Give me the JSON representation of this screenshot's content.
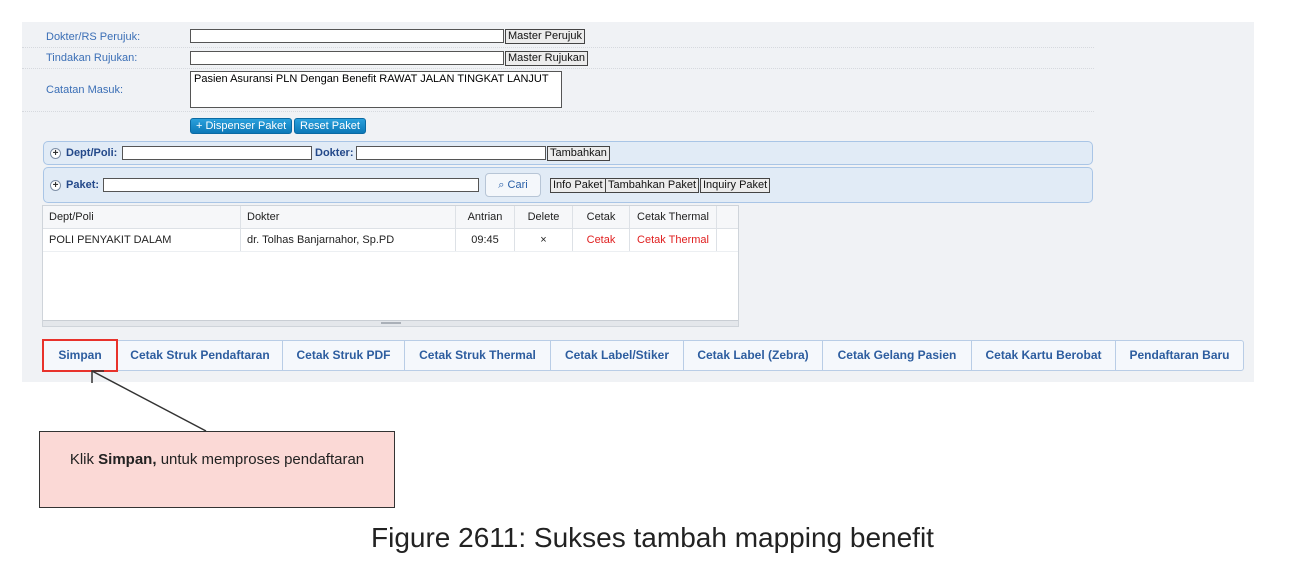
{
  "form": {
    "dokter_label": "Dokter/RS Perujuk:",
    "dokter_value": "",
    "master_perujuk_button": "Master Perujuk",
    "tindakan_label": "Tindakan Rujukan:",
    "tindakan_value": "",
    "master_rujukan_button": "Master Rujukan",
    "catatan_label": "Catatan Masuk:",
    "catatan_value": "Pasien Asuransi PLN Dengan Benefit RAWAT JALAN TINGKAT LANJUT",
    "dispenser_button": "+ Dispenser Paket",
    "reset_button": "Reset Paket"
  },
  "dept_bar": {
    "dept_label": "Dept/Poli:",
    "dept_value": "",
    "dokter_label": "Dokter:",
    "dokter_value": "",
    "tambahkan_button": "Tambahkan"
  },
  "paket_bar": {
    "paket_label": "Paket:",
    "paket_value": "",
    "cari_button": "Cari",
    "info_button": "Info Paket",
    "tambahkan_paket_button": "Tambahkan Paket",
    "inquiry_button": "Inquiry Paket"
  },
  "grid": {
    "columns": [
      "Dept/Poli",
      "Dokter",
      "Antrian",
      "Delete",
      "Cetak",
      "Cetak Thermal"
    ],
    "rows": [
      {
        "dept": "POLI PENYAKIT DALAM",
        "dokter": "dr. Tolhas Banjarnahor, Sp.PD",
        "antrian": "09:45",
        "delete": "×",
        "cetak": "Cetak",
        "cetak_thermal": "Cetak Thermal"
      }
    ]
  },
  "tabs": [
    "Simpan",
    "Cetak Struk Pendaftaran",
    "Cetak Struk PDF",
    "Cetak Struk Thermal",
    "Cetak Label/Stiker",
    "Cetak Label (Zebra)",
    "Cetak Gelang Pasien",
    "Cetak Kartu Berobat",
    "Pendaftaran Baru"
  ],
  "callout": {
    "prefix": "Klik ",
    "bold": "Simpan,",
    "suffix": " untuk memproses pendaftaran"
  },
  "caption": "Figure 2611: Sukses tambah mapping benefit",
  "colors": {
    "accent_blue": "#2d5d9f",
    "highlight_red": "#e8322b",
    "callout_bg": "#fbd9d6",
    "link_red": "#e02020"
  },
  "icons": [
    "plus-icon",
    "search-icon",
    "arrow-pointer"
  ]
}
